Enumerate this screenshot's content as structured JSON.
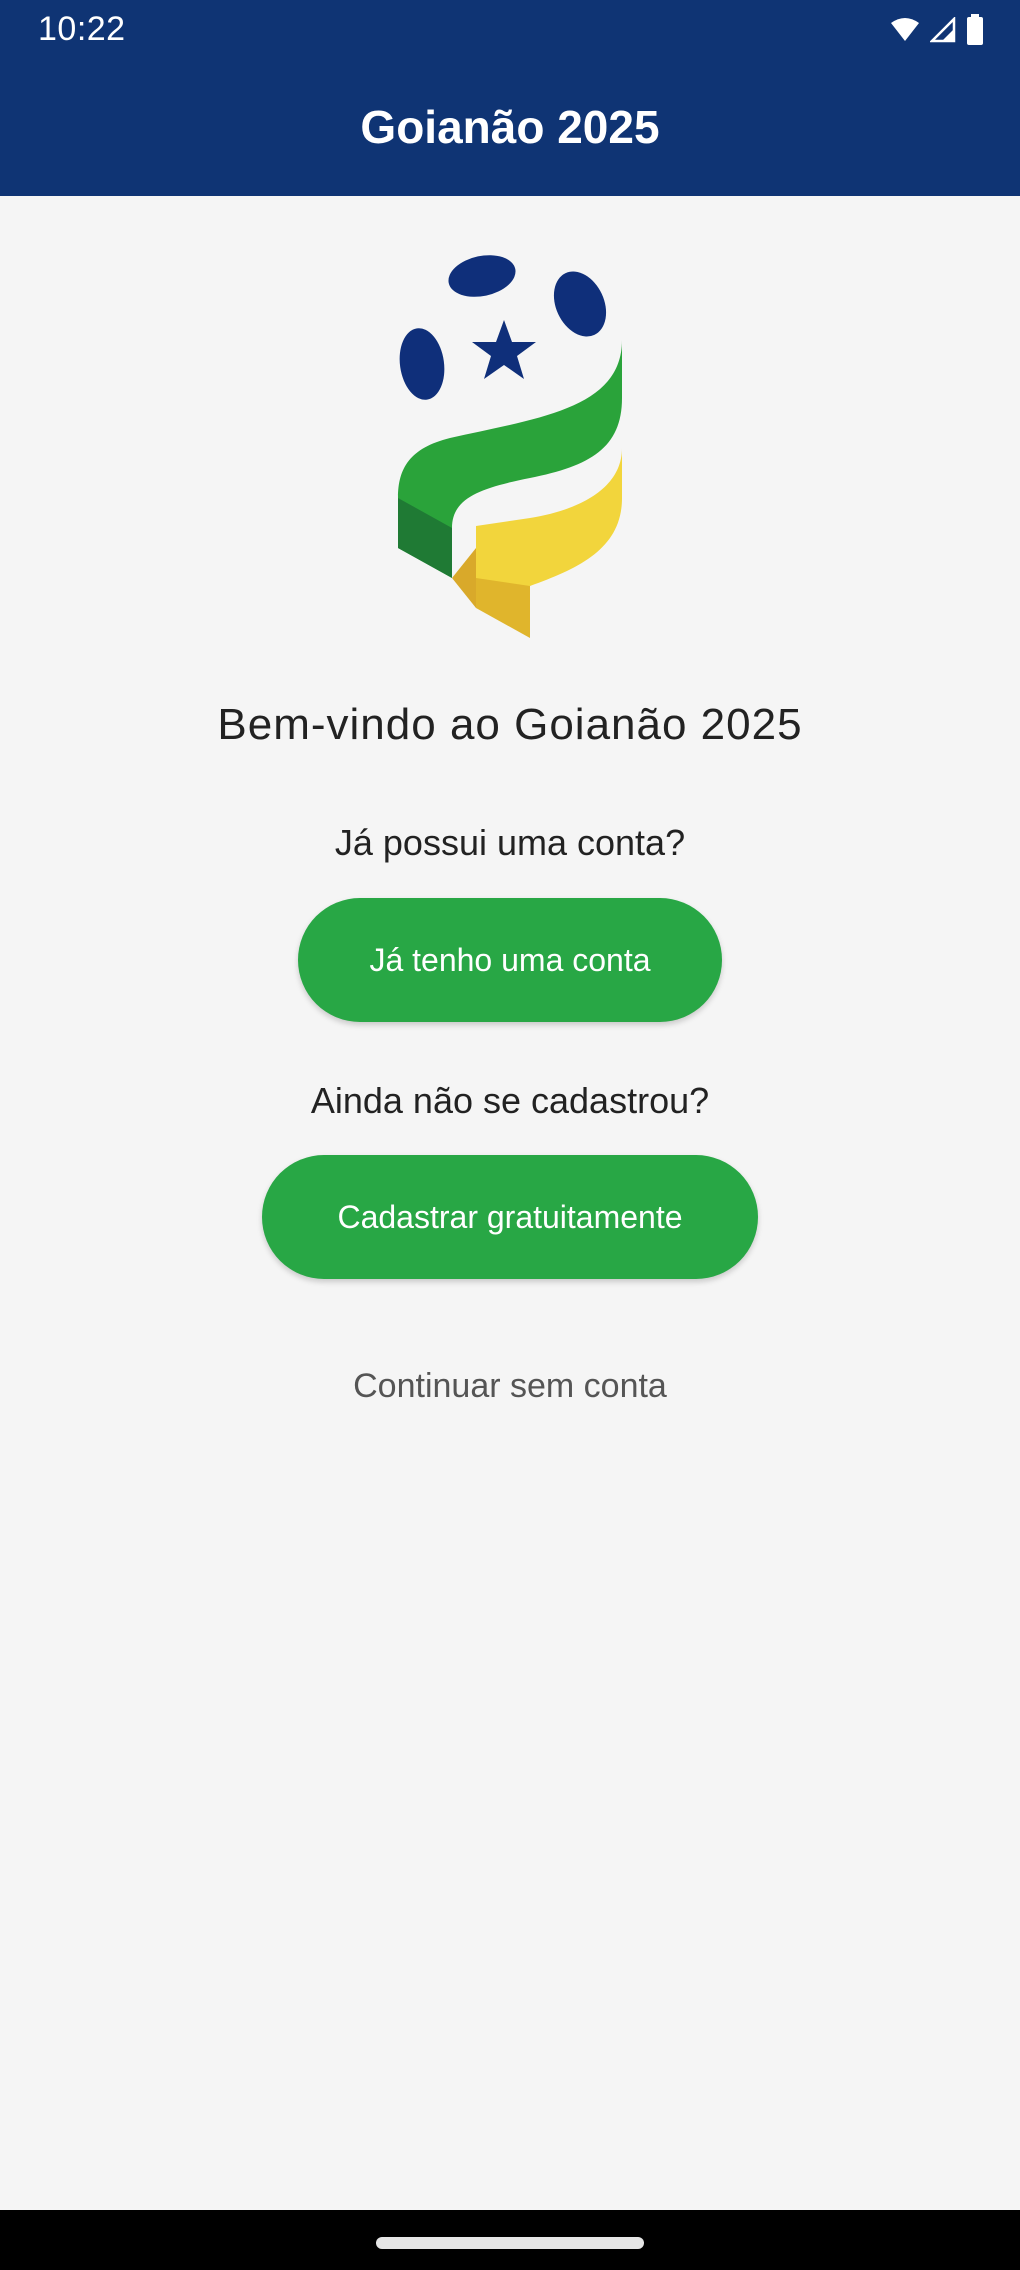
{
  "status_bar": {
    "time": "10:22",
    "icons": [
      "wifi-icon",
      "signal-icon",
      "battery-icon"
    ]
  },
  "app_bar": {
    "title": "Goianão 2025"
  },
  "logo": {
    "icon": "football-ribbon-logo"
  },
  "main": {
    "welcome": "Bem-vindo ao Goianão 2025",
    "has_account_question": "Já possui uma conta?",
    "login_button": "Já tenho uma conta",
    "not_registered_question": "Ainda não se cadastrou?",
    "register_button": "Cadastrar gratuitamente",
    "continue_link": "Continuar sem conta"
  },
  "colors": {
    "app_bar": "#0f3474",
    "button": "#28a745",
    "background": "#f5f5f5"
  }
}
